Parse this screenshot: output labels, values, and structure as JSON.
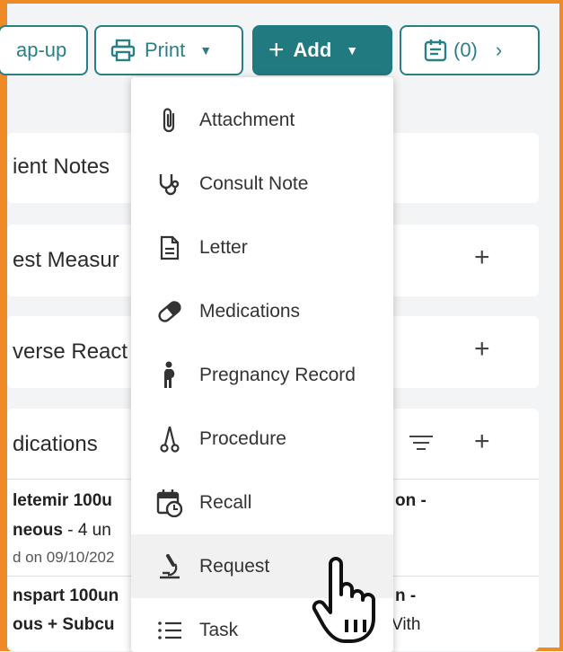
{
  "toolbar": {
    "wrapup_label": "ap-up",
    "print_label": "Print",
    "add_label": "Add",
    "calendar_count": "(0)"
  },
  "cards": {
    "patient_notes": "ient Notes",
    "best_measures": "est Measur",
    "adverse_reactions": "verse React",
    "medications": "dications"
  },
  "medications": {
    "row1_line1": "letemir 100u",
    "row1_line1_right": "on -",
    "row1_line2_bold": "neous",
    "row1_line2_rest": " - 4 un",
    "row1_line3": "d on 09/10/202",
    "row2_line1": "nspart 100un",
    "row2_line1_right": "n -",
    "row2_line2": "ous + Subcu",
    "row2_line2_right": "Vith"
  },
  "menu": {
    "items": [
      {
        "label": "Attachment",
        "icon": "paperclip-icon"
      },
      {
        "label": "Consult Note",
        "icon": "stethoscope-icon"
      },
      {
        "label": "Letter",
        "icon": "document-icon"
      },
      {
        "label": "Medications",
        "icon": "pill-icon"
      },
      {
        "label": "Pregnancy Record",
        "icon": "pregnant-person-icon"
      },
      {
        "label": "Procedure",
        "icon": "scissors-icon"
      },
      {
        "label": "Recall",
        "icon": "calendar-clock-icon"
      },
      {
        "label": "Request",
        "icon": "microscope-icon"
      },
      {
        "label": "Task",
        "icon": "list-icon"
      }
    ],
    "hovered_index": 7
  },
  "colors": {
    "accent": "#217a80",
    "frame": "#f08a24",
    "hover": "#f1f1f1"
  }
}
